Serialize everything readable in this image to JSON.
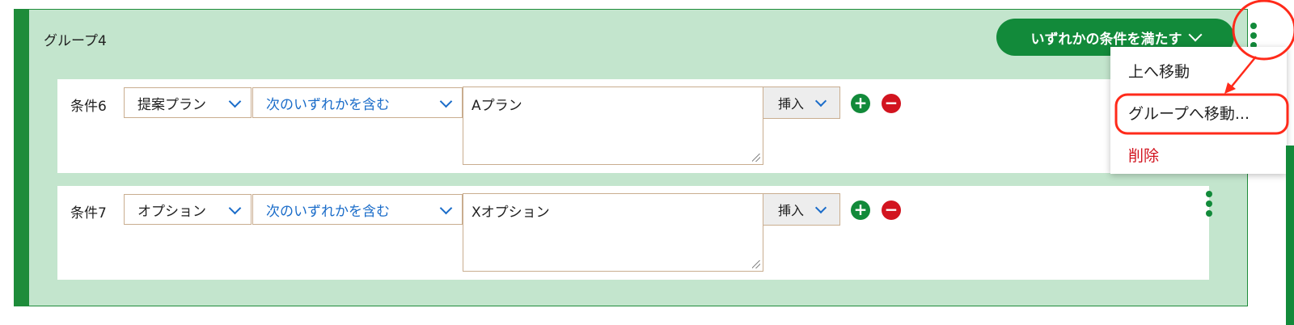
{
  "group": {
    "title": "グループ4",
    "match_mode": "いずれかの条件を満たす"
  },
  "conditions": [
    {
      "label": "条件6",
      "field": "提案プラン",
      "operator": "次のいずれかを含む",
      "value": "Aプラン",
      "insert_label": "挿入"
    },
    {
      "label": "条件7",
      "field": "オプション",
      "operator": "次のいずれかを含む",
      "value": "Xオプション",
      "insert_label": "挿入"
    }
  ],
  "menu": {
    "items": [
      "上へ移動",
      "グループへ移動...",
      "削除"
    ]
  },
  "colors": {
    "group_bg": "#c3e5cd",
    "accent_green": "#128a3a",
    "delete_red": "#d2141f",
    "link_blue": "#1a6cc9",
    "annotation_red": "#ff2a1a"
  },
  "icons": {
    "add": "plus-circle-icon",
    "remove": "minus-circle-icon",
    "more": "kebab-menu-icon",
    "dropdown": "chevron-down-icon"
  }
}
